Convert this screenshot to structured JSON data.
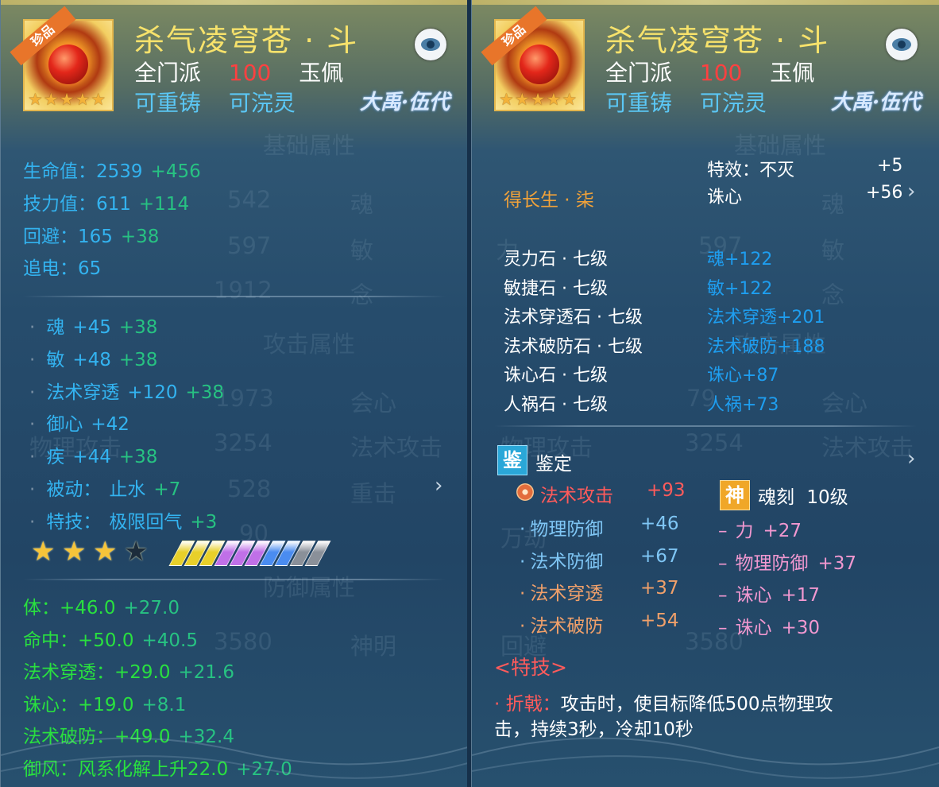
{
  "left": {
    "item_name": "杀气凌穹苍 · 斗",
    "rarity_tag": "珍品",
    "faction": "全门派",
    "level": "100",
    "slot": "玉佩",
    "tag_recast": "可重铸",
    "tag_reforge": "可浣灵",
    "server_logo": "大禹·伍代",
    "base_stats": [
      {
        "label": "生命值：",
        "value": "2539",
        "bonus": "+456"
      },
      {
        "label": "技力值：",
        "value": "611",
        "bonus": "+114"
      },
      {
        "label": "回避：",
        "value": "165",
        "bonus": "+38"
      },
      {
        "label": "追电：",
        "value": "65",
        "bonus": ""
      }
    ],
    "sub_stats": [
      {
        "bullet": "·",
        "label": "魂",
        "value": "+45",
        "bonus": "+38"
      },
      {
        "bullet": "·",
        "label": "敏",
        "value": "+48",
        "bonus": "+38"
      },
      {
        "bullet": "·",
        "label": "法术穿透",
        "value": "+120",
        "bonus": "+38"
      },
      {
        "bullet": "·",
        "label": "御心",
        "value": "+42",
        "bonus": ""
      },
      {
        "bullet": "·",
        "label": "疾",
        "value": "+44",
        "bonus": "+38"
      },
      {
        "bullet": "·",
        "label": "被动：",
        "value": "止水",
        "bonus": "+7"
      },
      {
        "bullet": "·",
        "label": "特技：",
        "value": "极限回气",
        "bonus": "+3"
      }
    ],
    "star_rating": {
      "filled": 3,
      "total": 4
    },
    "crystal_colors": [
      "#e8d02a",
      "#e8d02a",
      "#e8d02a",
      "#c070e8",
      "#c070e8",
      "#c070e8",
      "#4a8cf0",
      "#4a8cf0",
      "#8a9099",
      "#8a9099"
    ],
    "extra_stats": [
      {
        "label": "体：",
        "value": "+46.0",
        "bonus": "+27.0"
      },
      {
        "label": "命中：",
        "value": "+50.0",
        "bonus": "+40.5"
      },
      {
        "label": "法术穿透：",
        "value": "+29.0",
        "bonus": "+21.6"
      },
      {
        "label": "诛心：",
        "value": "+19.0",
        "bonus": "+8.1"
      },
      {
        "label": "法术破防：",
        "value": "+49.0",
        "bonus": "+32.4"
      },
      {
        "label": "御风：",
        "value": "风系化解上升22.0",
        "bonus": "+27.0"
      }
    ]
  },
  "right": {
    "item_name": "杀气凌穹苍 · 斗",
    "rarity_tag": "珍品",
    "faction": "全门派",
    "level": "100",
    "slot": "玉佩",
    "tag_recast": "可重铸",
    "tag_reforge": "可浣灵",
    "server_logo": "大禹·伍代",
    "set_name": "得长生 · 柒",
    "effect_label": "特效：不灭",
    "effect_value": "+5",
    "effect2_label": "诛心",
    "effect2_value": "+56",
    "gems": [
      {
        "name": "灵力石 · 七级",
        "effect": "魂+122"
      },
      {
        "name": "敏捷石 · 七级",
        "effect": "敏+122"
      },
      {
        "name": "法术穿透石 · 七级",
        "effect": "法术穿透+201"
      },
      {
        "name": "法术破防石 · 七级",
        "effect": "法术破防+188"
      },
      {
        "name": "诛心石 · 七级",
        "effect": "诛心+87"
      },
      {
        "name": "人祸石 · 七级",
        "effect": "人祸+73"
      }
    ],
    "appraisal_badge": "鉴",
    "appraisal_title": "鉴定",
    "appraisal_main": {
      "label": "法术攻击",
      "value": "+93"
    },
    "appraisal_stats": [
      {
        "bullet": "·",
        "label": "物理防御",
        "value": "+46"
      },
      {
        "bullet": "·",
        "label": "法术防御",
        "value": "+67"
      },
      {
        "bullet": "·",
        "label": "法术穿透",
        "value": "+37"
      },
      {
        "bullet": "·",
        "label": "法术破防",
        "value": "+54"
      }
    ],
    "soul_badge": "神",
    "soul_title": "魂刻",
    "soul_level": "10级",
    "soul_stats": [
      {
        "bullet": "–",
        "label": "力",
        "value": "+27"
      },
      {
        "bullet": "–",
        "label": "物理防御",
        "value": "+37"
      },
      {
        "bullet": "–",
        "label": "诛心",
        "value": "+17"
      },
      {
        "bullet": "–",
        "label": "诛心",
        "value": "+30"
      }
    ],
    "skill_header": "<特技>",
    "skill_name": "· 折戟：",
    "skill_desc_line1": "攻击时，使目标降低500点物理攻",
    "skill_desc_line2": "击，持续3秒，冷却10秒"
  },
  "colors": {
    "title": "#f7e26b",
    "stat_blue": "#33b3f0",
    "bonus_green": "#27c282",
    "extra_green": "#29e03f",
    "level_red": "#ff4040",
    "set_orange": "#f0a23a",
    "soul_pink": "#f198d0"
  }
}
